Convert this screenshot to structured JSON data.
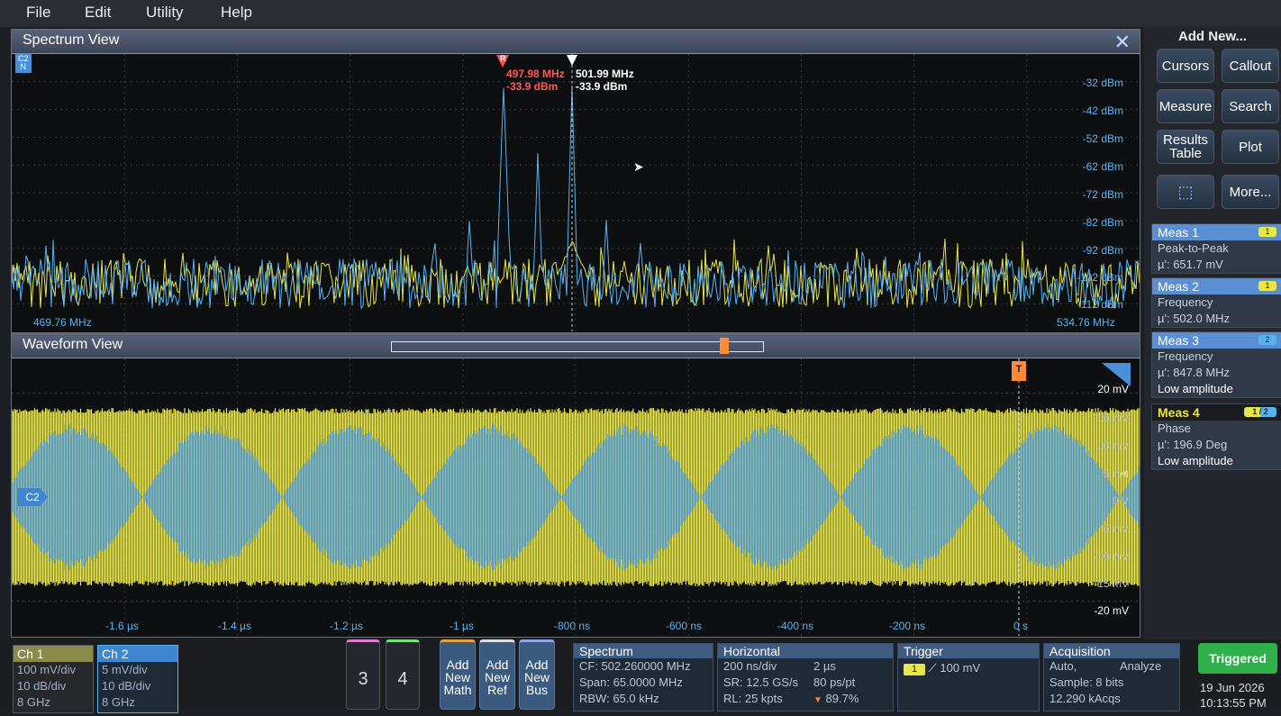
{
  "menu": [
    "File",
    "Edit",
    "Utility",
    "Help"
  ],
  "spectrum": {
    "title": "Spectrum View",
    "channel_badge": [
      "C2",
      "N"
    ],
    "ylabels": [
      "-32 dBm",
      "-42 dBm",
      "-52 dBm",
      "-62 dBm",
      "-72 dBm",
      "-82 dBm",
      "-92 dBm",
      "-102 dBm",
      "-112 dBm"
    ],
    "f_start": "469.76 MHz",
    "f_stop": "534.76 MHz",
    "marker_r_letter": "R",
    "marker_r_freq": "497.98 MHz",
    "marker_r_level": "-33.9 dBm",
    "marker_a_freq": "501.99 MHz",
    "marker_a_level": "-33.9 dBm"
  },
  "waveform": {
    "title": "Waveform View",
    "channel_badge": "C2",
    "trigger_marker": "T",
    "vlabels": [
      "20 mV",
      "15 mV",
      "10 mV",
      "5 mV",
      "0 V",
      "-5 mV",
      "-10 mV",
      "-15 mV",
      "-20 mV"
    ],
    "tlabels": [
      "-1.6 µs",
      "-1.4 µs",
      "-1.2 µs",
      "-1 µs",
      "-800 ns",
      "-600 ns",
      "-400 ns",
      "-200 ns",
      "0 s"
    ]
  },
  "rightpanel": {
    "add_new": "Add New...",
    "buttons": [
      [
        "Cursors",
        "Callout"
      ],
      [
        "Measure",
        "Search"
      ],
      [
        "Results Table",
        "Plot"
      ],
      [
        "",
        "More..."
      ]
    ],
    "measurements": [
      {
        "name": "Meas 1",
        "tag": "1",
        "lines": [
          "Peak-to-Peak",
          "µ': 651.7 mV"
        ]
      },
      {
        "name": "Meas 2",
        "tag": "1",
        "lines": [
          "Frequency",
          "µ': 502.0 MHz"
        ]
      },
      {
        "name": "Meas 3",
        "tag": "2",
        "lines": [
          "Frequency",
          "µ': 847.8 MHz",
          "Low amplitude"
        ]
      },
      {
        "name": "Meas 4",
        "tag": "1 / 2",
        "lines": [
          "Phase",
          "µ': 196.9 Deg",
          "Low amplitude"
        ]
      }
    ]
  },
  "bottom": {
    "ch1": {
      "title": "Ch 1",
      "lines": [
        "100 mV/div",
        "10 dB/div",
        "8 GHz"
      ]
    },
    "ch2": {
      "title": "Ch 2",
      "lines": [
        "5 mV/div",
        "10 dB/div",
        "8 GHz"
      ]
    },
    "num3": "3",
    "num4": "4",
    "add_math": "Add New Math",
    "add_ref": "Add New Ref",
    "add_bus": "Add New Bus",
    "spectrum_box": {
      "title": "Spectrum",
      "lines": [
        "CF: 502.260000 MHz",
        "Span: 65.0000 MHz",
        "RBW: 65.0 kHz"
      ]
    },
    "horizontal_box": {
      "title": "Horizontal",
      "l1a": "200 ns/div",
      "l1b": "2 µs",
      "l2a": "SR: 12.5 GS/s",
      "l2b": "80 ps/pt",
      "l3a": "RL: 25 kpts",
      "l3b": "89.7%"
    },
    "trigger_box": {
      "title": "Trigger",
      "source": "1",
      "level": "100 mV"
    },
    "acquisition_box": {
      "title": "Acquisition",
      "l1a": "Auto,",
      "l1b": "Analyze",
      "l2": "Sample: 8 bits",
      "l3": "12.290 kAcqs"
    },
    "status": "Triggered",
    "date": "19 Jun 2026",
    "time": "10:13:55 PM"
  },
  "colors": {
    "ch1": "#e8e64a",
    "ch2": "#58b2f0",
    "marker_ref": "#ff4d4d",
    "triggered": "#2fb04a"
  }
}
